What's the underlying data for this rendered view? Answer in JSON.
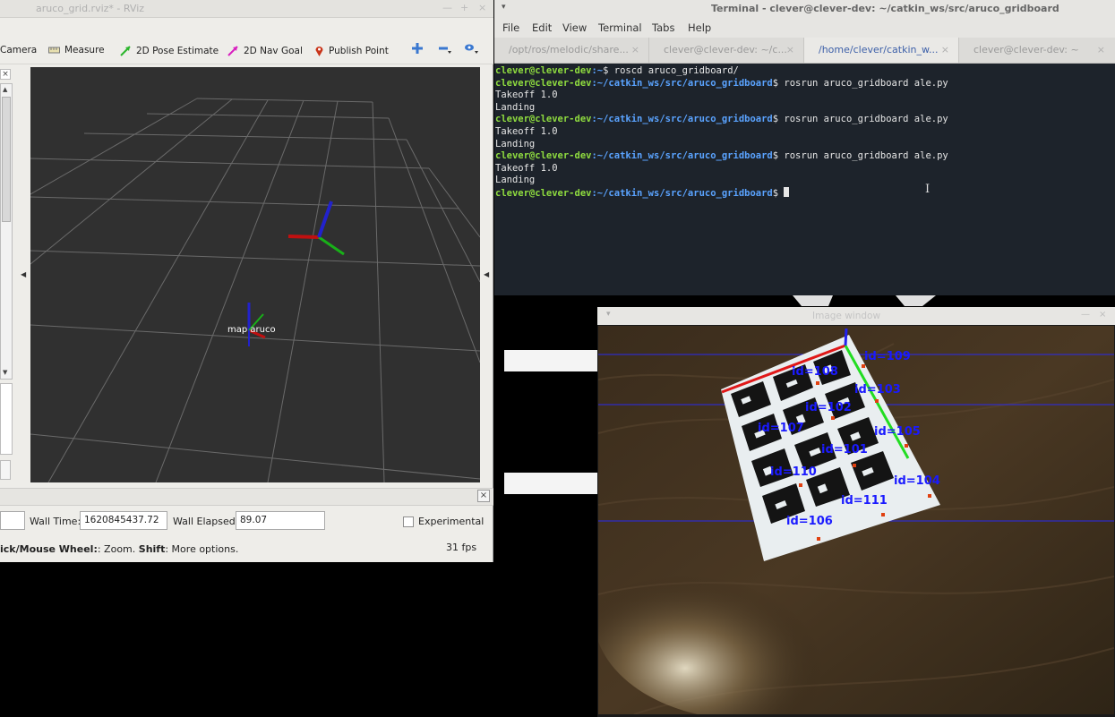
{
  "rviz": {
    "window_title": "aruco_grid.rviz* - RViz",
    "toolbar": {
      "camera": "Camera",
      "measure": "Measure",
      "pose_estimate": "2D Pose Estimate",
      "nav_goal": "2D Nav Goal",
      "publish_point": "Publish Point"
    },
    "scene_label": "map aruco",
    "time": {
      "wall_time_label": "Wall Time:",
      "wall_time_value": "1620845437.72",
      "wall_elapsed_label": "Wall Elapsed:",
      "wall_elapsed_value": "89.07",
      "experimental_label": "Experimental"
    },
    "status": {
      "hint_bold": "ick/Mouse Wheel:",
      "hint_text": ": Zoom. ",
      "hint_shift": "Shift",
      "hint_more": ": More options.",
      "fps": "31 fps"
    }
  },
  "terminal": {
    "window_title": "Terminal - clever@clever-dev: ~/catkin_ws/src/aruco_gridboard",
    "menu": [
      "File",
      "Edit",
      "View",
      "Terminal",
      "Tabs",
      "Help"
    ],
    "tabs": [
      {
        "label": "/opt/ros/melodic/share...",
        "active": false
      },
      {
        "label": "clever@clever-dev: ~/c...",
        "active": false
      },
      {
        "label": "/home/clever/catkin_w...",
        "active": true
      },
      {
        "label": "clever@clever-dev: ~",
        "active": false
      }
    ],
    "lines": [
      {
        "user": "clever@clever-dev",
        "path": ":~",
        "cmd": "$ roscd aruco_gridboard/"
      },
      {
        "user": "clever@clever-dev",
        "path": ":~/catkin_ws/src/aruco_gridboard",
        "cmd": "$ rosrun aruco_gridboard ale.py"
      },
      {
        "text": "Takeoff 1.0"
      },
      {
        "text": "Landing"
      },
      {
        "user": "clever@clever-dev",
        "path": ":~/catkin_ws/src/aruco_gridboard",
        "cmd": "$ rosrun aruco_gridboard ale.py"
      },
      {
        "text": "Takeoff 1.0"
      },
      {
        "text": "Landing"
      },
      {
        "user": "clever@clever-dev",
        "path": ":~/catkin_ws/src/aruco_gridboard",
        "cmd": "$ rosrun aruco_gridboard ale.py"
      },
      {
        "text": "Takeoff 1.0"
      },
      {
        "text": "Landing"
      },
      {
        "user": "clever@clever-dev",
        "path": ":~/catkin_ws/src/aruco_gridboard",
        "cmd": "$ ",
        "cursor": true
      }
    ]
  },
  "image_window": {
    "window_title": "Image window",
    "marker_labels": [
      "id=109",
      "id=108",
      "id=103",
      "id=102",
      "id=105",
      "id=107",
      "id=101",
      "id=110",
      "id=104",
      "id=111",
      "id=106"
    ]
  },
  "colors": {
    "terminal_bg": "#1d232b",
    "terminal_user": "#8fdc3f",
    "terminal_path": "#5aa3ff",
    "viewport_bg": "#303030",
    "marker_label": "#1a1aff"
  }
}
